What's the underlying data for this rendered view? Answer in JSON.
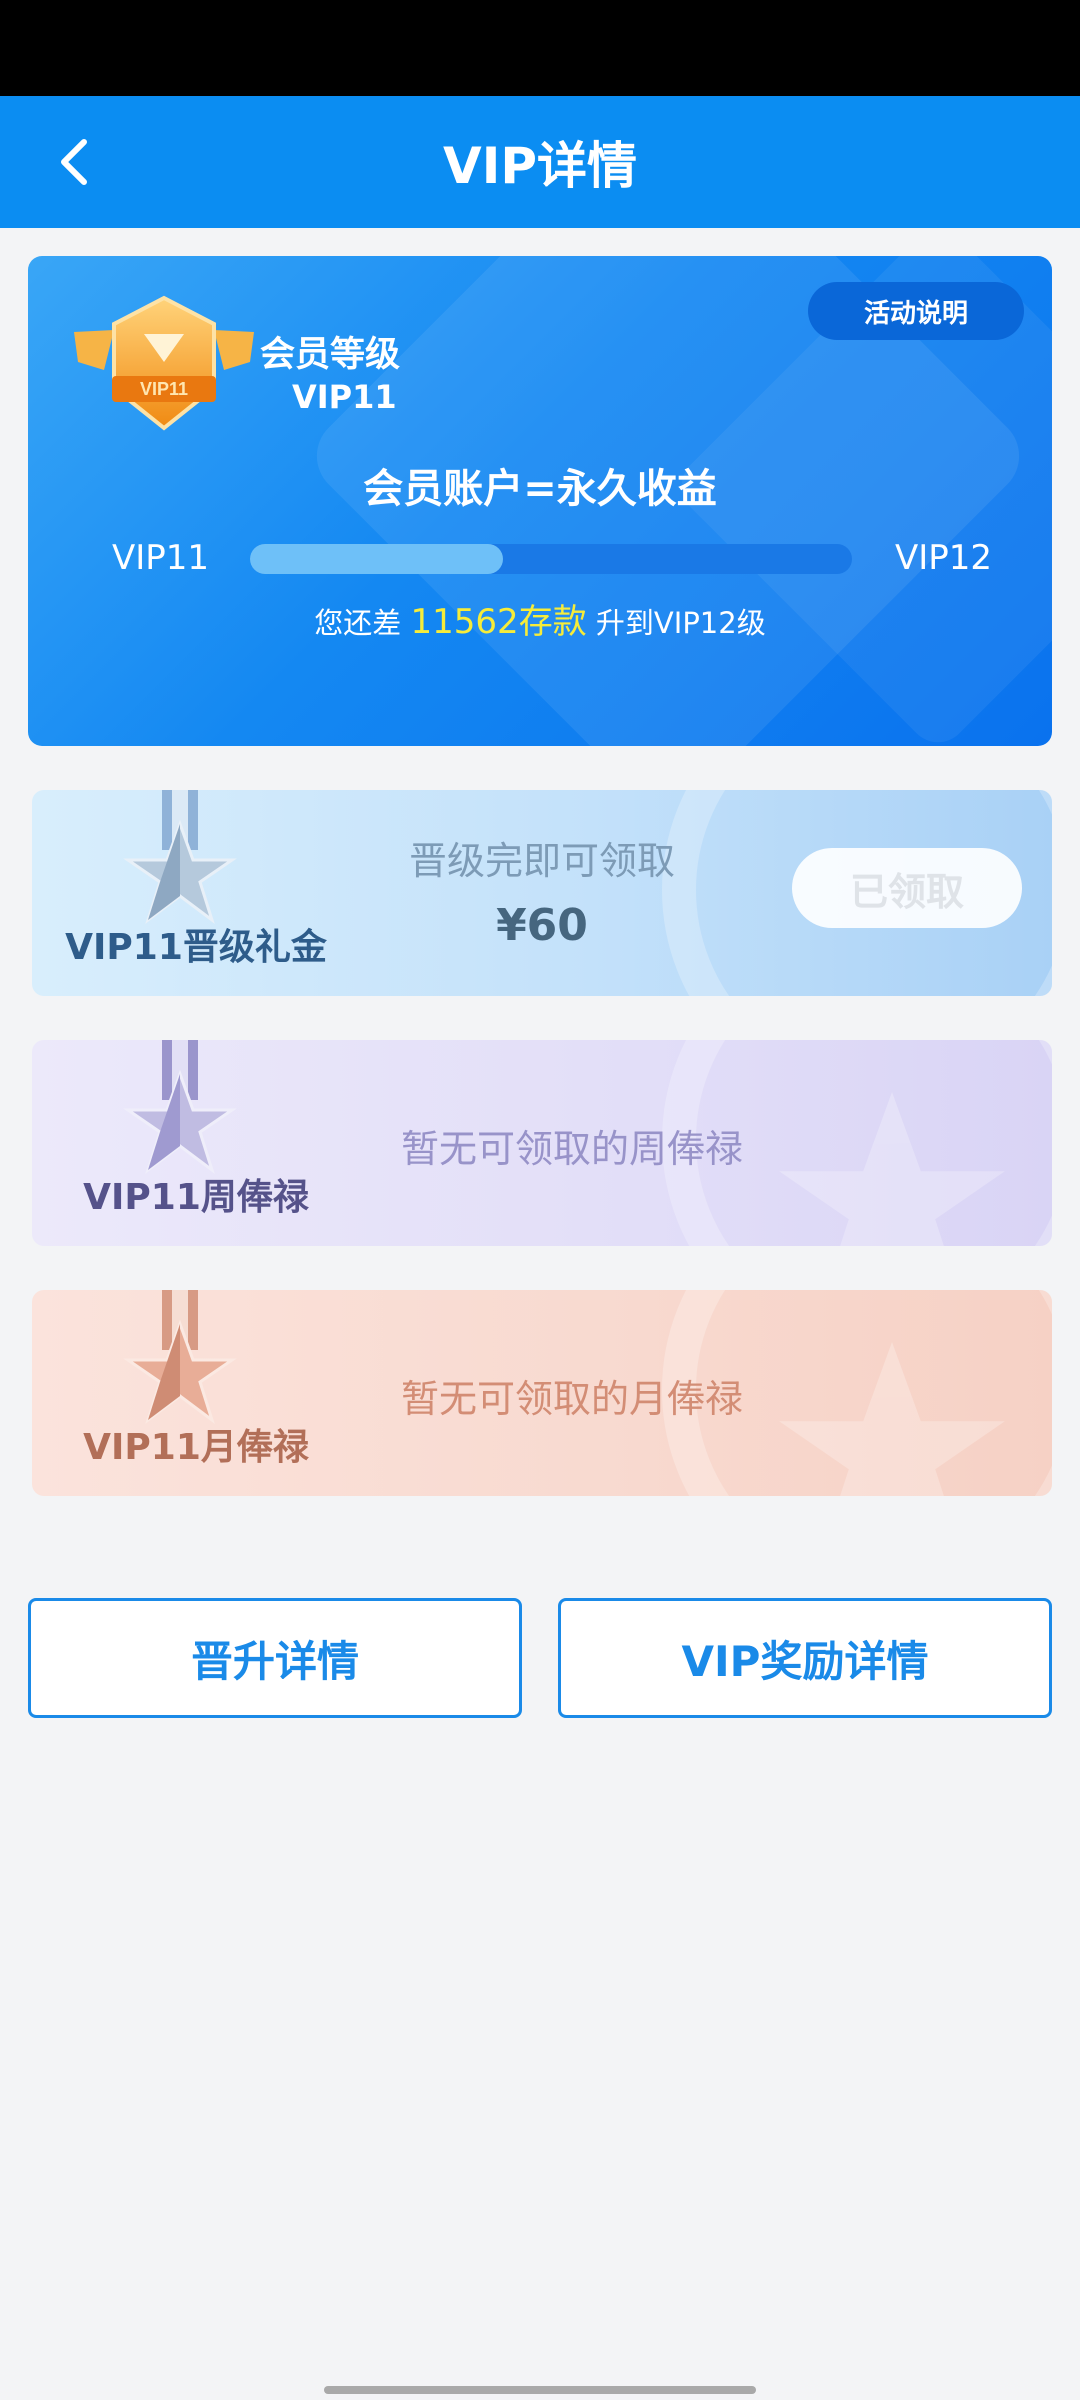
{
  "header": {
    "title": "VIP详情"
  },
  "vip_card": {
    "activity_label": "活动说明",
    "level_label": "会员等级",
    "level_value": "VIP11",
    "badge_text": "VIP11",
    "slogan": "会员账户=永久收益",
    "progress": {
      "current_level": "VIP11",
      "next_level": "VIP12",
      "fraction": 0.42
    },
    "remain": {
      "prefix": "您还差",
      "amount": "11562存款",
      "suffix": "升到VIP12级"
    }
  },
  "rewards": {
    "upgrade": {
      "name": "VIP11晋级礼金",
      "message": "晋级完即可领取",
      "amount": "¥60",
      "button": "已领取"
    },
    "weekly": {
      "name": "VIP11周俸禄",
      "message": "暂无可领取的周俸禄"
    },
    "monthly": {
      "name": "VIP11月俸禄",
      "message": "暂无可领取的月俸禄"
    }
  },
  "buttons": {
    "promotion_details": "晋升详情",
    "vip_reward_details": "VIP奖励详情"
  },
  "colors": {
    "header": "#0b8df2",
    "highlight": "#f6ec3a",
    "button_border": "#1a8ae8"
  }
}
